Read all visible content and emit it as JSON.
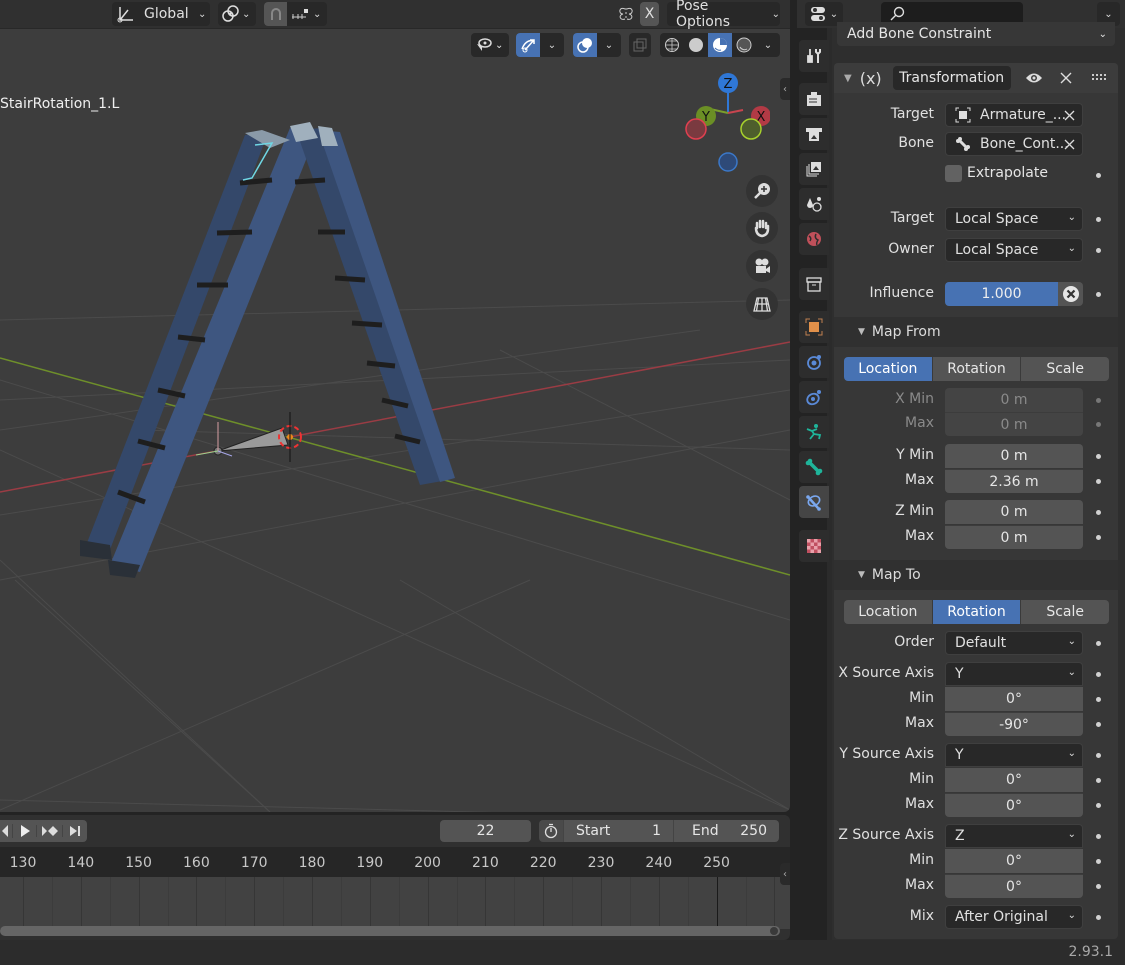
{
  "viewport": {
    "header": {
      "transform_orientation": "Global",
      "pose_x_mirror_label": "X",
      "pose_options_label": "Pose Options"
    },
    "active_object_name": "StairRotation_1.L",
    "gizmo_axes": {
      "z": "Z",
      "y": "Y",
      "x": "X"
    },
    "colors": {
      "x_axis": "#c8454f",
      "y_axis": "#7a9e2b",
      "z_axis": "#2f77d6",
      "grid": "#4a4a4a",
      "ladder": "#3b5274"
    },
    "nav_buttons": [
      "zoom-icon",
      "pan-hand-icon",
      "camera-icon",
      "orthographic-grid-icon"
    ]
  },
  "timeline": {
    "current_frame": "22",
    "start_label": "Start",
    "start_value": "1",
    "end_label": "End",
    "end_value": "250",
    "ruler_ticks": [
      "130",
      "140",
      "150",
      "160",
      "170",
      "180",
      "190",
      "200",
      "210",
      "220",
      "230",
      "240",
      "250"
    ]
  },
  "properties": {
    "search_placeholder": "",
    "add_constraint_label": "Add Bone Constraint",
    "constraint": {
      "type_icon": "(x)",
      "name": "Transformation",
      "target_label": "Target",
      "target_value": "Armature_...",
      "bone_label": "Bone",
      "bone_value": "Bone_Cont...",
      "extrapolate_label": "Extrapolate",
      "extrapolate_checked": false,
      "target_space_label": "Target",
      "target_space_value": "Local Space",
      "owner_space_label": "Owner",
      "owner_space_value": "Local Space",
      "influence_label": "Influence",
      "influence_value": "1.000",
      "influence_fraction": 1.0
    },
    "map_from": {
      "title": "Map From",
      "modes": [
        "Location",
        "Rotation",
        "Scale"
      ],
      "active_mode": "Location",
      "x_min_label": "X Min",
      "x_min": "0 m",
      "x_max_label": "Max",
      "x_max": "0 m",
      "y_min_label": "Y Min",
      "y_min": "0 m",
      "y_max_label": "Max",
      "y_max": "2.36 m",
      "z_min_label": "Z Min",
      "z_min": "0 m",
      "z_max_label": "Max",
      "z_max": "0 m"
    },
    "map_to": {
      "title": "Map To",
      "modes": [
        "Location",
        "Rotation",
        "Scale"
      ],
      "active_mode": "Rotation",
      "order_label": "Order",
      "order_value": "Default",
      "x_source_label": "X Source Axis",
      "x_source": "Y",
      "x_min_label": "Min",
      "x_min": "0°",
      "x_max_label": "Max",
      "x_max": "-90°",
      "y_source_label": "Y Source Axis",
      "y_source": "Y",
      "y_min_label": "Min",
      "y_min": "0°",
      "y_max_label": "Max",
      "y_max": "0°",
      "z_source_label": "Z Source Axis",
      "z_source": "Z",
      "z_min_label": "Min",
      "z_min": "0°",
      "z_max_label": "Max",
      "z_max": "0°",
      "mix_label": "Mix",
      "mix_value": "After Original"
    },
    "tabs": [
      "tool",
      "render",
      "output",
      "view-layer",
      "scene",
      "world",
      "collection",
      "object",
      "physics",
      "object-constraints",
      "object-data-armature",
      "bone",
      "bone-constraints",
      "texture"
    ],
    "active_tab": "bone-constraints"
  },
  "status_bar": {
    "version": "2.93.1"
  }
}
